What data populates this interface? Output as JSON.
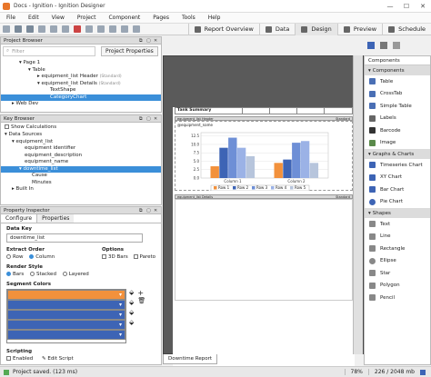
{
  "window": {
    "title": "Docs - Ignition - Ignition Designer"
  },
  "menu": [
    "File",
    "Edit",
    "View",
    "Project",
    "Component",
    "Pages",
    "Tools",
    "Help"
  ],
  "toolbar": {
    "project_properties": "Project Properties",
    "tabs": [
      "Report Overview",
      "Data",
      "Design",
      "Preview",
      "Schedule"
    ]
  },
  "project_browser": {
    "title": "Project Browser",
    "filter_placeholder": "Filter",
    "items": [
      {
        "label": "Page 1",
        "tag": ""
      },
      {
        "label": "Table",
        "tag": ""
      },
      {
        "label": "equipment_list Header",
        "tag": "(Standard)"
      },
      {
        "label": "equipment_list Details",
        "tag": "(Standard)"
      },
      {
        "label": "TextShape",
        "tag": ""
      },
      {
        "label": "CategoryChart",
        "tag": ""
      },
      {
        "label": "Web Dev",
        "tag": ""
      }
    ]
  },
  "key_browser": {
    "title": "Key Browser",
    "show_calculations": "Show Calculations",
    "items": [
      "Data Sources",
      "equipment_list",
      "equipment identifier",
      "equipment_description",
      "equipment_name",
      "downtime_list",
      "Cause",
      "Minutes",
      "Built In"
    ]
  },
  "property_inspector": {
    "title": "Property Inspector",
    "tabs": [
      "Configure",
      "Properties"
    ],
    "data_key_label": "Data Key",
    "data_key_value": "downtime_list",
    "extract_order_label": "Extract Order",
    "extract_order_options": [
      "Row",
      "Column"
    ],
    "options_label": "Options",
    "options_items": [
      "3D Bars",
      "Pareto"
    ],
    "render_style_label": "Render Style",
    "render_style_options": [
      "Bars",
      "Stacked",
      "Layered"
    ],
    "segment_colors_label": "Segment Colors",
    "segment_colors": [
      "#f2913c",
      "#3d64b5",
      "#3d64b5",
      "#3d64b5",
      "#3d64b5"
    ],
    "scripting_label": "Scripting",
    "scripting_enabled": "Enabled",
    "edit_script": "Edit Script"
  },
  "canvas": {
    "tank_summary": "Tank Summary",
    "header_band": "equipment_list Header",
    "standard_tag": "Standard",
    "details_band": "equipment_list Details",
    "chart_field": "@equipment_name",
    "bottom_tab": "Downtime Report"
  },
  "chart_data": {
    "type": "bar",
    "categories": [
      "Column 1",
      "Column 2"
    ],
    "series": [
      {
        "name": "Row 1",
        "values": [
          3.5,
          4.5
        ]
      },
      {
        "name": "Row 2",
        "values": [
          9.0,
          5.5
        ]
      },
      {
        "name": "Row 3",
        "values": [
          12.0,
          10.5
        ]
      },
      {
        "name": "Row 4",
        "values": [
          9.0,
          11.0
        ]
      },
      {
        "name": "Row 5",
        "values": [
          6.5,
          4.5
        ]
      }
    ],
    "colors": [
      "#f2913c",
      "#3d64b5",
      "#6e8fd6",
      "#9bb2e6",
      "#b7c5dc"
    ],
    "yticks": [
      "12.5",
      "10.0",
      "7.5",
      "5.0",
      "2.5",
      "0.0"
    ],
    "ylim": [
      0,
      13.5
    ]
  },
  "components": {
    "tab_label": "Components",
    "sections": [
      {
        "title": "Components",
        "items": [
          "Table",
          "CrossTab",
          "Simple Table",
          "Labels",
          "Barcode",
          "Image"
        ]
      },
      {
        "title": "Graphs & Charts",
        "items": [
          "Timeseries Chart",
          "XY Chart",
          "Bar Chart",
          "Pie Chart"
        ]
      },
      {
        "title": "Shapes",
        "items": [
          "Text",
          "Line",
          "Rectangle",
          "Ellipse",
          "Star",
          "Polygon",
          "Pencil"
        ]
      }
    ]
  },
  "status": {
    "message": "Project saved. (123 ms)",
    "zoom": "78%",
    "memory": "226 / 2048 mb"
  }
}
